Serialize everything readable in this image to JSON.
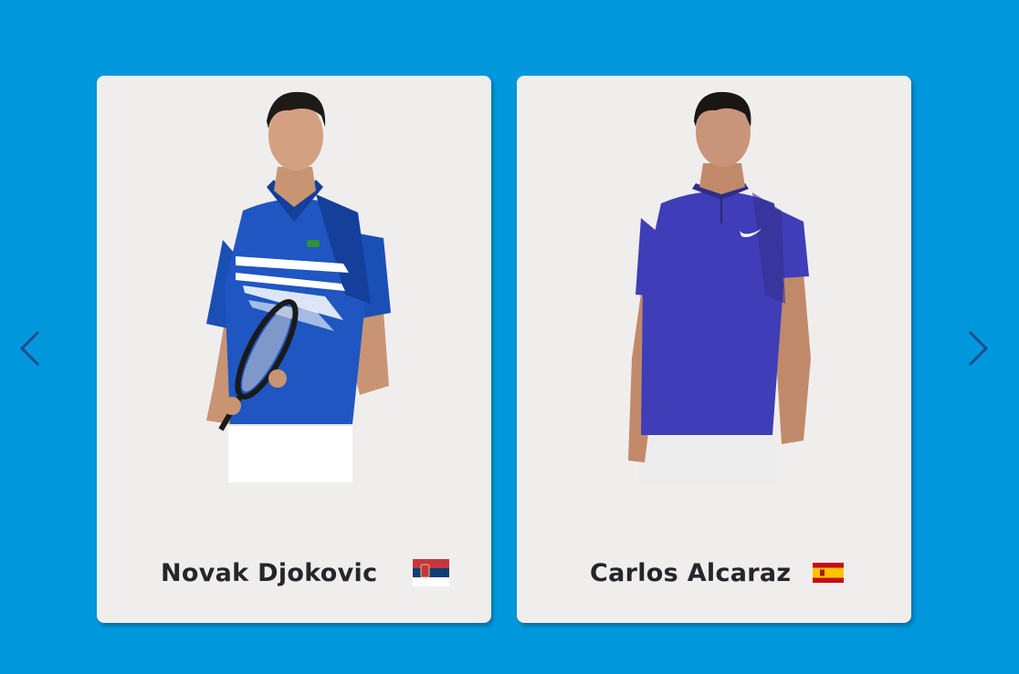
{
  "carousel": {
    "prev_icon": "chevron-left-icon",
    "next_icon": "chevron-right-icon",
    "players": [
      {
        "name": "Novak Djokovic",
        "flag": "serbia-flag",
        "shirt_color": "#1f56c1"
      },
      {
        "name": "Carlos Alcaraz",
        "flag": "spain-flag",
        "shirt_color": "#3f3db7"
      }
    ]
  },
  "colors": {
    "background": "#0097dc",
    "card": "#f0eded",
    "name_text": "#23262b",
    "arrow": "#1a4f8c"
  }
}
